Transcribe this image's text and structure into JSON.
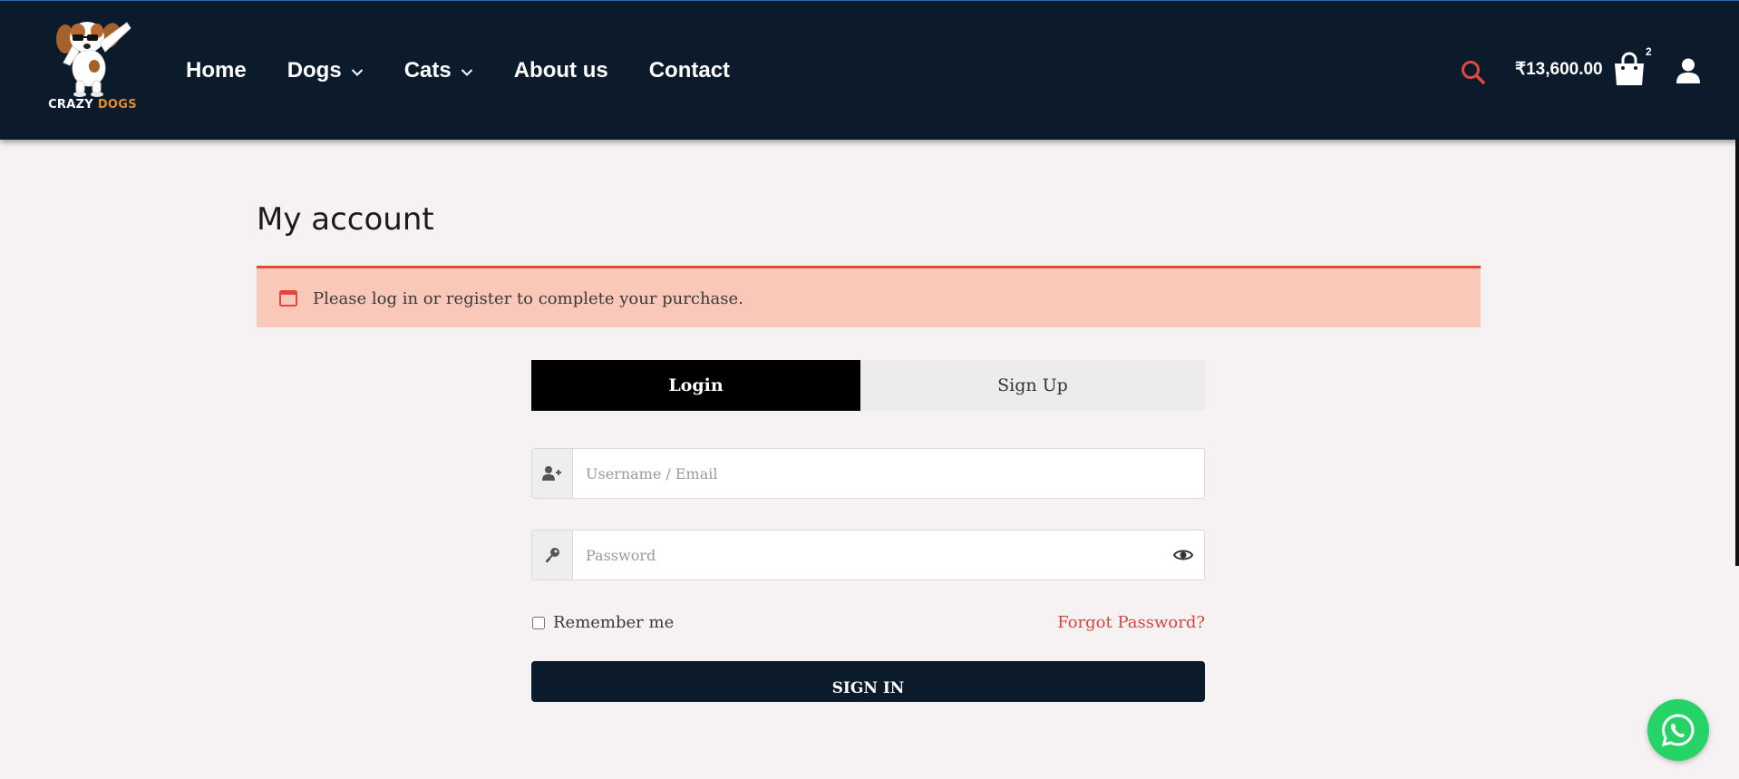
{
  "brand": {
    "word1": "CRAZY",
    "word2": "DOGS",
    "accent_color": "#e58a2c"
  },
  "nav": {
    "items": [
      {
        "label": "Home",
        "has_dropdown": false
      },
      {
        "label": "Dogs",
        "has_dropdown": true
      },
      {
        "label": "Cats",
        "has_dropdown": true
      },
      {
        "label": "About us",
        "has_dropdown": false
      },
      {
        "label": "Contact",
        "has_dropdown": false
      }
    ]
  },
  "header": {
    "search_icon": "search-icon",
    "cart_total": "₹13,600.00",
    "cart_count": "2",
    "cart_icon": "shopping-bag-icon",
    "account_icon": "user-icon",
    "background_color": "#0b1b2b"
  },
  "page": {
    "title": "My account"
  },
  "notice": {
    "text": "Please log in or register to complete your purchase.",
    "icon": "browser-window-icon",
    "background_color": "#f9c8b8",
    "border_color": "#e0483e"
  },
  "auth": {
    "tabs": [
      {
        "label": "Login",
        "active": true
      },
      {
        "label": "Sign Up",
        "active": false
      }
    ],
    "username": {
      "placeholder": "Username / Email",
      "value": "",
      "icon": "user-plus-icon"
    },
    "password": {
      "placeholder": "Password",
      "value": "",
      "icon": "key-icon",
      "toggle_icon": "eye-icon"
    },
    "remember_label": "Remember me",
    "remember_checked": false,
    "forgot_label": "Forgot Password?",
    "submit_label": "SIGN IN"
  },
  "floating": {
    "icon": "whatsapp-icon",
    "color": "#25d366"
  }
}
